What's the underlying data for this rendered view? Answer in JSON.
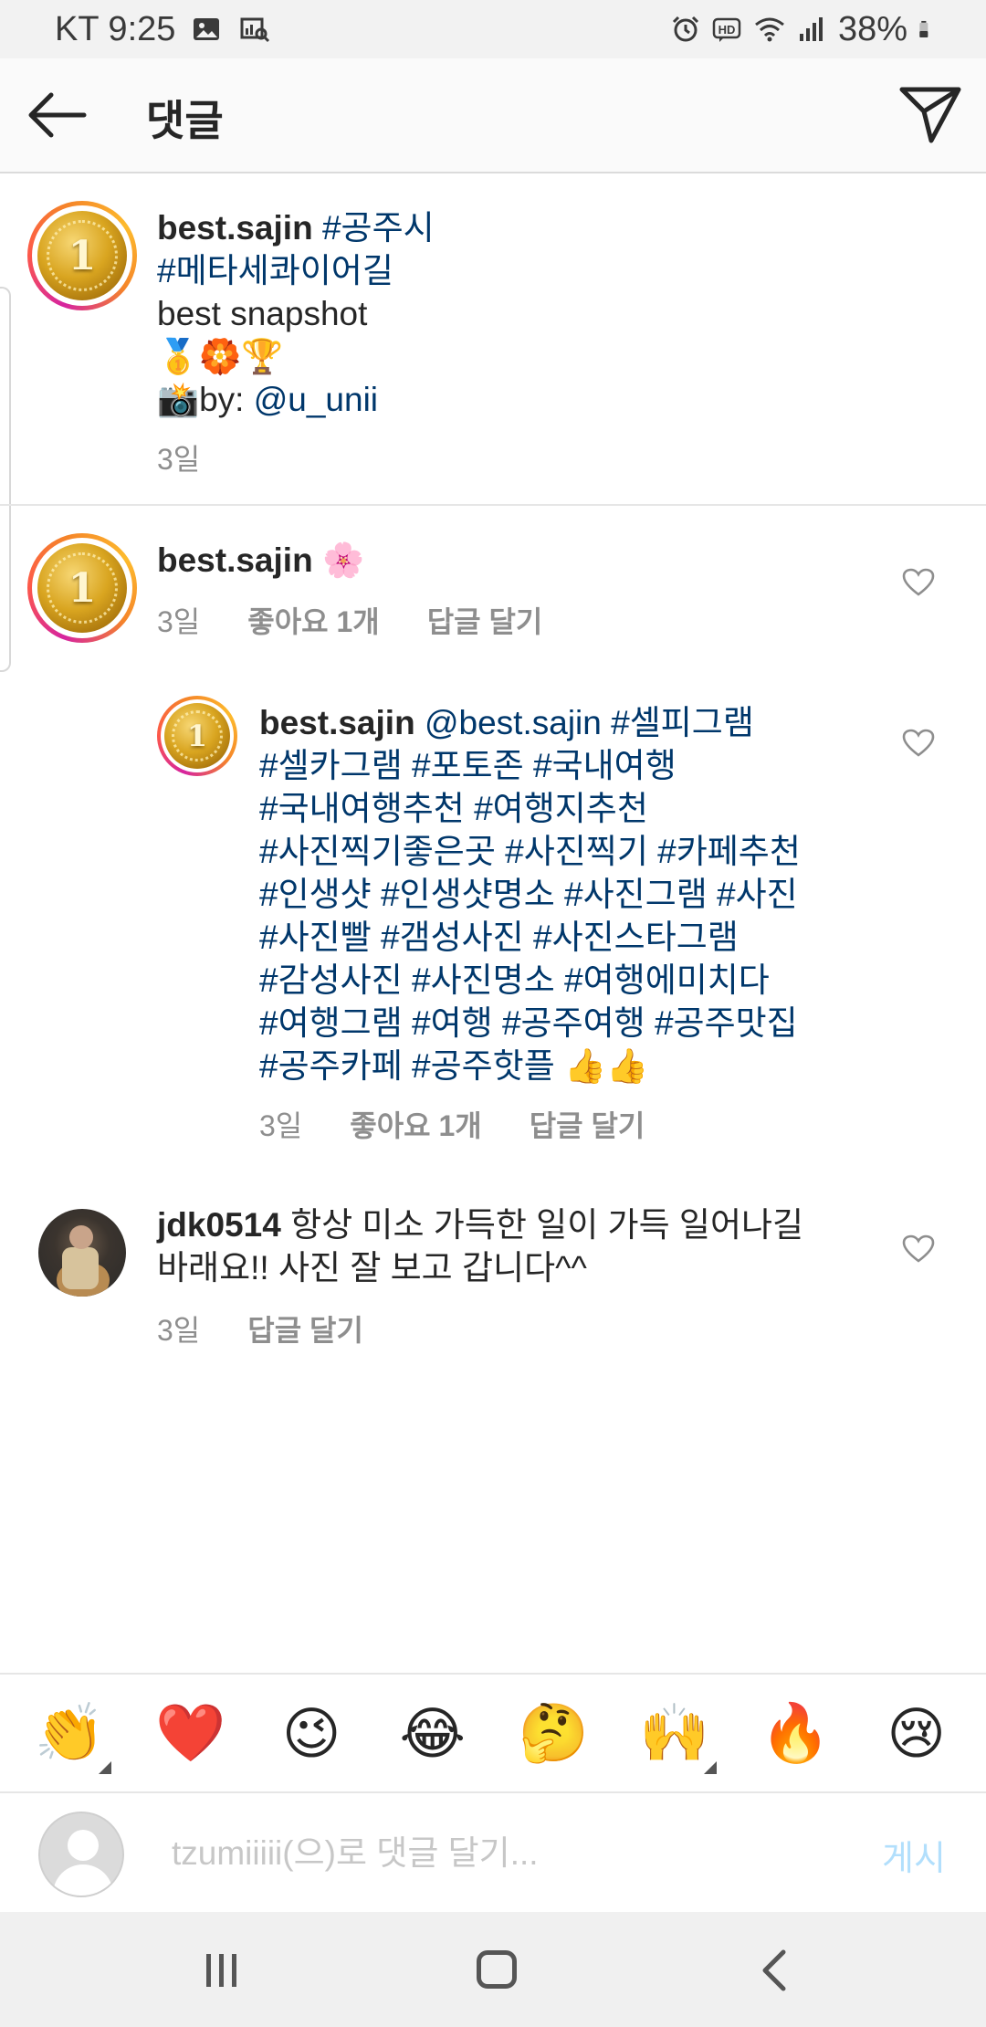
{
  "status_bar": {
    "carrier_time": "KT 9:25",
    "battery": "38%",
    "icons_left": [
      "image-icon",
      "scan-icon"
    ],
    "icons_right": [
      "alarm-icon",
      "hd-icon",
      "wifi-icon",
      "signal-icon",
      "battery-icon"
    ]
  },
  "header": {
    "title": "댓글",
    "back_icon": "arrow-left-icon",
    "send_icon": "paper-plane-icon"
  },
  "caption": {
    "username": "best.sajin",
    "tag1": "#공주시",
    "tag2": "#메타세콰이어길",
    "line3": "best snapshot",
    "emojis": "🥇🏵️🏆",
    "credit_prefix": "📸by: ",
    "credit_mention": "@u_unii",
    "time": "3일"
  },
  "comments": [
    {
      "username": "best.sajin",
      "text": "🌸",
      "time": "3일",
      "likes": "좋아요 1개",
      "reply": "답글 달기"
    },
    {
      "username": "best.sajin",
      "mention": "@best.sajin",
      "tags_line1": "#셀피그램",
      "tags_line2": "#셀카그램 #포토존 #국내여행",
      "tags_line3": "#국내여행추천 #여행지추천",
      "tags_line4": "#사진찍기좋은곳 #사진찍기 #카페추천",
      "tags_line5": "#인생샷 #인생샷명소 #사진그램 #사진",
      "tags_line6": "#사진빨 #갬성사진 #사진스타그램",
      "tags_line7": "#감성사진 #사진명소 #여행에미치다",
      "tags_line8": "#여행그램 #여행 #공주여행 #공주맛집",
      "tags_line9": "#공주카페 #공주핫플",
      "tags_emoji": " 👍👍",
      "time": "3일",
      "likes": "좋아요 1개",
      "reply": "답글 달기"
    },
    {
      "username": "jdk0514",
      "text_line1": "항상 미소 가득한 일이 가득 일어나길",
      "text_line2": "바래요!! 사진 잘 보고 갑니다^^",
      "time": "3일",
      "reply": "답글 달기"
    }
  ],
  "avatar_badge": "1",
  "emoji_bar": [
    "👏",
    "❤️",
    "😉",
    "😂",
    "🤔",
    "🙌",
    "🔥",
    "😢"
  ],
  "input": {
    "placeholder": "tzumiiiii(으)로 댓글 달기...",
    "post_label": "게시"
  },
  "colors": {
    "hashtag": "#00376b",
    "meta": "#8e8e8e",
    "post_button": "#b2dffc"
  }
}
